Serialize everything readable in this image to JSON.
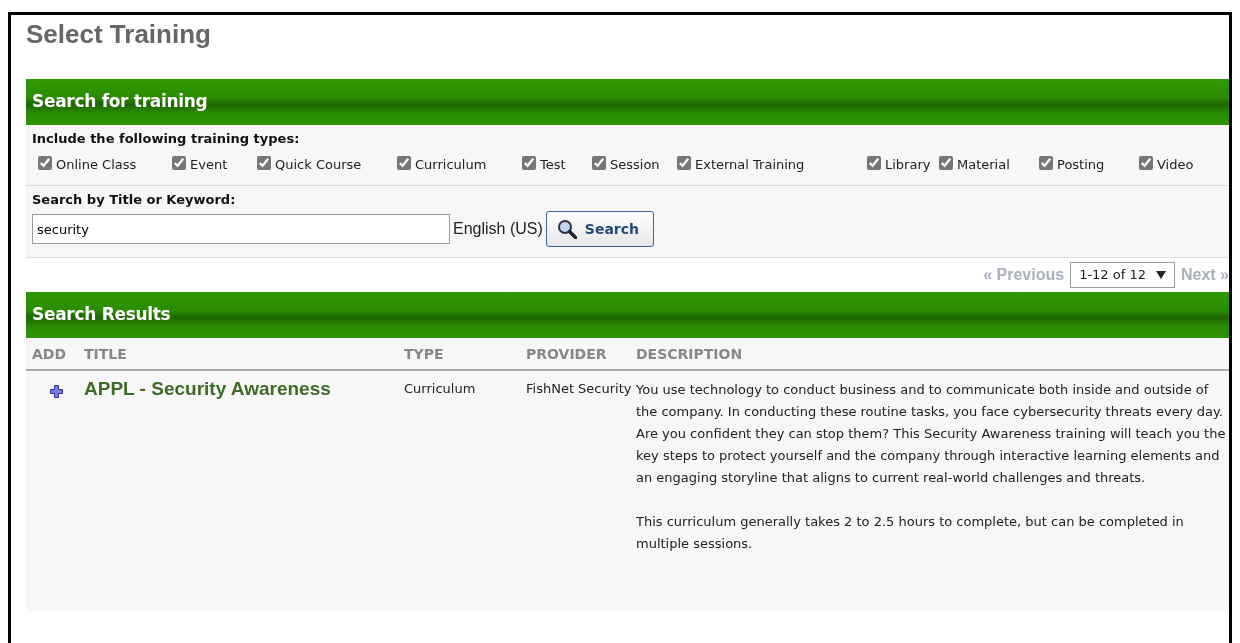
{
  "page_title": "Select Training",
  "search_panel": {
    "title": "Search for training",
    "types_label": "Include the following training types:",
    "types": [
      {
        "label": "Online Class",
        "checked": true
      },
      {
        "label": "Event",
        "checked": true
      },
      {
        "label": "Quick Course",
        "checked": true
      },
      {
        "label": "Curriculum",
        "checked": true
      },
      {
        "label": "Test",
        "checked": true
      },
      {
        "label": "Session",
        "checked": true
      },
      {
        "label": "External Training",
        "checked": true
      },
      {
        "label": "Library",
        "checked": true
      },
      {
        "label": "Material",
        "checked": true
      },
      {
        "label": "Posting",
        "checked": true
      },
      {
        "label": "Video",
        "checked": true
      }
    ],
    "keyword_label": "Search by Title or Keyword:",
    "keyword": {
      "value": "security"
    },
    "language": "English (US)",
    "search_button": "Search"
  },
  "pager": {
    "previous": "« Previous",
    "range": "1-12 of 12",
    "next": "Next »"
  },
  "results": {
    "title": "Search Results",
    "columns": [
      "ADD",
      "TITLE",
      "TYPE",
      "PROVIDER",
      "DESCRIPTION"
    ],
    "rows": [
      {
        "title": "APPL - Security Awareness",
        "type": "Curriculum",
        "provider": "FishNet Security",
        "description": [
          "You use technology to conduct business and to communicate both inside and outside of the company. In conducting these routine tasks, you face cybersecurity threats every day. Are you confident they can stop them? This Security Awareness training will teach you the key steps to protect yourself and the company through interactive learning elements and an engaging storyline that aligns to current real-world challenges and threats.",
          "This curriculum generally takes 2 to 2.5 hours to complete, but can be completed in multiple sessions."
        ]
      }
    ]
  }
}
